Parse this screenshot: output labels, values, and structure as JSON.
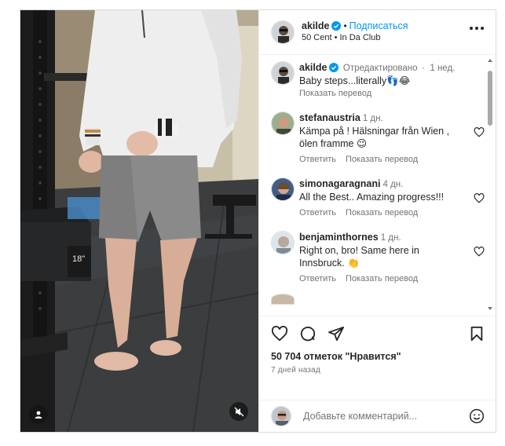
{
  "post": {
    "author": "akilde",
    "follow_label": "Подписаться",
    "dot": "•",
    "location_text": "50 Cent • In Da Club",
    "more_label": "More options"
  },
  "caption": {
    "username": "akilde",
    "edited_label": "Отредактировано",
    "dot": "·",
    "time": "1 нед.",
    "text": "Baby steps...literally👣😂",
    "translate_label": "Показать перевод"
  },
  "comments": [
    {
      "username": "stefanaustria",
      "time": "1 дн.",
      "text": "Kämpa på ! Hälsningar från Wien , ölen framme 😉",
      "reply_label": "Ответить",
      "translate_label": "Показать перевод"
    },
    {
      "username": "simonagaragnani",
      "time": "4 дн.",
      "text": "All the Best.. Amazing progress!!!",
      "reply_label": "Ответить",
      "translate_label": "Показать перевод"
    },
    {
      "username": "benjaminthornes",
      "time": "1 дн.",
      "text": "Right on, bro! Same here in Innsbruck. 👏",
      "reply_label": "Ответить",
      "translate_label": "Показать перевод"
    }
  ],
  "actions": {
    "likes_text": "50 704 отметок \"Нравится\"",
    "date_text": "7 дней назад"
  },
  "add_comment": {
    "placeholder": "Добавьте комментарий..."
  },
  "media": {
    "plate_label": "18\""
  },
  "colors": {
    "accent": "#0095f6",
    "verified": "#0095f6",
    "text": "#262626",
    "muted": "#737373",
    "border": "#dbdbdb"
  },
  "icons": [
    "more-icon",
    "verified-icon",
    "heart-icon",
    "comment-icon",
    "share-icon",
    "bookmark-icon",
    "emoji-icon",
    "user-tag-icon",
    "mute-icon"
  ]
}
